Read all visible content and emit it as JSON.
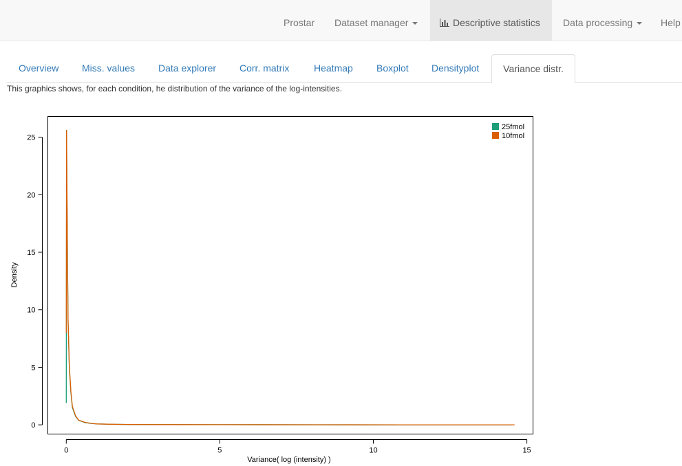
{
  "navbar": {
    "brand": "Prostar",
    "items": [
      {
        "label": "Dataset manager",
        "dropdown": true,
        "active": false
      },
      {
        "label": "Descriptive statistics",
        "icon": "bar-chart-icon",
        "active": true
      },
      {
        "label": "Data processing",
        "dropdown": true,
        "active": false
      },
      {
        "label": "Help",
        "dropdown": false,
        "active": false
      }
    ]
  },
  "tabs": [
    {
      "label": "Overview",
      "active": false
    },
    {
      "label": "Miss. values",
      "active": false
    },
    {
      "label": "Data explorer",
      "active": false
    },
    {
      "label": "Corr. matrix",
      "active": false
    },
    {
      "label": "Heatmap",
      "active": false
    },
    {
      "label": "Boxplot",
      "active": false
    },
    {
      "label": "Densityplot",
      "active": false
    },
    {
      "label": "Variance distr.",
      "active": true
    }
  ],
  "description": "This graphics shows, for each condition, he distribution of the variance of the log-intensities.",
  "colors": {
    "series_25fmol": "#1b9e77",
    "series_10fmol": "#d95f02",
    "link": "#337ab7"
  },
  "chart_data": {
    "type": "line",
    "title": "",
    "xlabel": "Variance( log (intensity) )",
    "ylabel": "Density",
    "xlim": [
      -0.6,
      15.2
    ],
    "ylim": [
      -0.8,
      26.8
    ],
    "xticks": [
      0,
      5,
      10,
      15
    ],
    "yticks": [
      0,
      5,
      10,
      15,
      20,
      25
    ],
    "grid": false,
    "legend_position": "top-right",
    "series": [
      {
        "name": "25fmol",
        "color": "#1b9e77",
        "x": [
          0.0,
          0.01,
          0.02,
          0.04,
          0.06,
          0.1,
          0.15,
          0.2,
          0.3,
          0.4,
          0.6,
          0.8,
          1.0,
          1.5,
          2.0,
          3.0,
          5.0,
          8.0,
          11.0,
          14.5
        ],
        "y": [
          1.9,
          25.6,
          21.0,
          14.0,
          9.0,
          5.0,
          2.8,
          1.5,
          0.75,
          0.4,
          0.2,
          0.12,
          0.08,
          0.05,
          0.03,
          0.02,
          0.01,
          0.005,
          0.003,
          0.0
        ]
      },
      {
        "name": "10fmol",
        "color": "#d95f02",
        "x": [
          0.0,
          0.01,
          0.02,
          0.04,
          0.06,
          0.1,
          0.15,
          0.2,
          0.3,
          0.4,
          0.6,
          0.8,
          1.0,
          1.5,
          2.0,
          3.0,
          5.0,
          8.0,
          11.0,
          14.6
        ],
        "y": [
          8.0,
          25.6,
          21.5,
          14.5,
          9.2,
          5.2,
          2.9,
          1.6,
          0.8,
          0.42,
          0.22,
          0.13,
          0.08,
          0.05,
          0.03,
          0.02,
          0.01,
          0.005,
          0.003,
          0.0
        ]
      }
    ]
  }
}
